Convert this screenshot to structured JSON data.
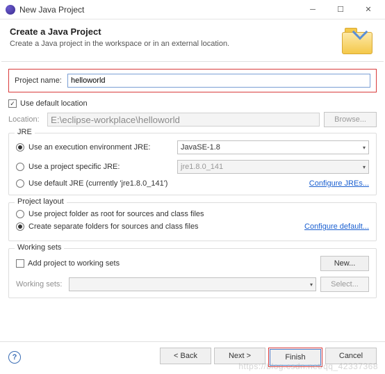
{
  "window": {
    "title": "New Java Project"
  },
  "header": {
    "title": "Create a Java Project",
    "subtitle": "Create a Java project in the workspace or in an external location."
  },
  "project": {
    "name_label": "Project name:",
    "name_value": "helloworld",
    "use_default_label": "Use default location",
    "location_label": "Location:",
    "location_value": "E:\\eclipse-workplace\\helloworld",
    "browse_label": "Browse..."
  },
  "jre": {
    "group_title": "JRE",
    "opt1_label": "Use an execution environment JRE:",
    "opt1_value": "JavaSE-1.8",
    "opt2_label": "Use a project specific JRE:",
    "opt2_value": "jre1.8.0_141",
    "opt3_label": "Use default JRE (currently 'jre1.8.0_141')",
    "configure_link": "Configure JREs..."
  },
  "layout": {
    "group_title": "Project layout",
    "opt1_label": "Use project folder as root for sources and class files",
    "opt2_label": "Create separate folders for sources and class files",
    "configure_link": "Configure default..."
  },
  "working_sets": {
    "group_title": "Working sets",
    "add_label": "Add project to working sets",
    "new_label": "New...",
    "ws_label": "Working sets:",
    "select_label": "Select..."
  },
  "footer": {
    "back": "< Back",
    "next": "Next >",
    "finish": "Finish",
    "cancel": "Cancel"
  },
  "watermark": "https://blog.csdn.net/qq_42337368"
}
